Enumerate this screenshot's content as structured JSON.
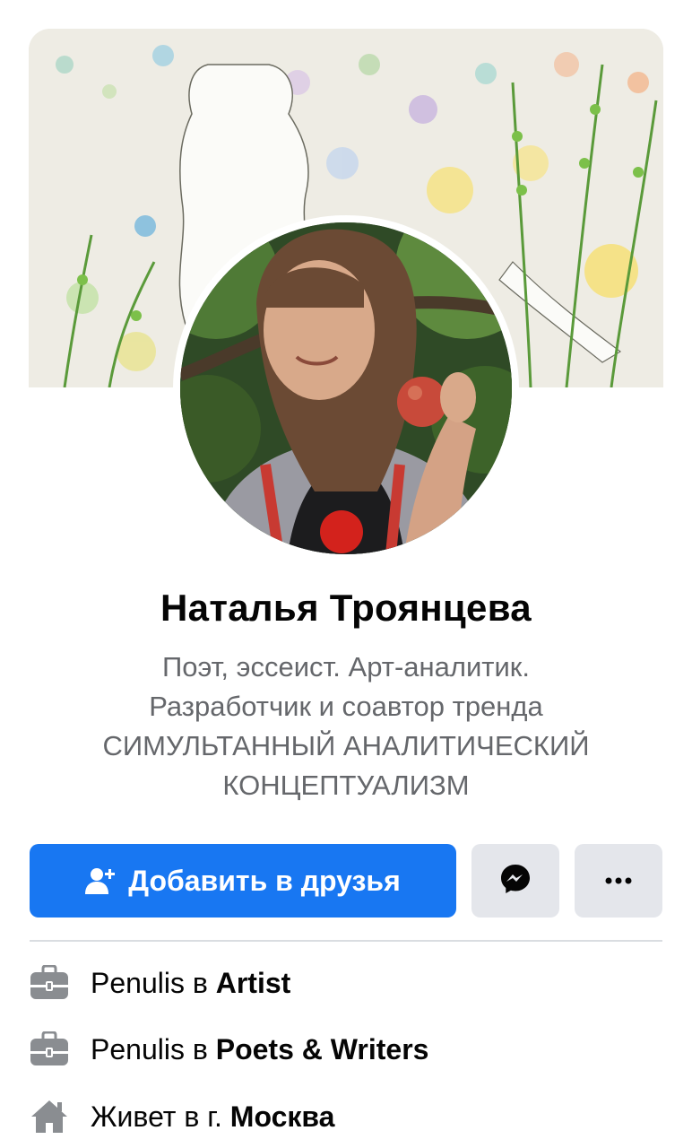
{
  "profile": {
    "name": "Наталья Троянцева",
    "bio_lines": [
      "Поэт, эссеист. Арт-аналитик.",
      "Разработчик и соавтор тренда",
      "СИМУЛЬТАННЫЙ АНАЛИТИЧЕСКИЙ",
      "КОНЦЕПТУАЛИЗМ"
    ]
  },
  "actions": {
    "add_friend_label": "Добавить в друзья",
    "add_friend_icon": "add-user-icon",
    "messenger_icon": "messenger-icon",
    "more_label": "···"
  },
  "info": [
    {
      "icon": "briefcase-icon",
      "prefix": "Penulis в ",
      "value": "Artist"
    },
    {
      "icon": "briefcase-icon",
      "prefix": "Penulis в ",
      "value": "Poets & Writers"
    },
    {
      "icon": "home-icon",
      "prefix": "Живет в г. ",
      "value": "Москва"
    }
  ],
  "colors": {
    "primary": "#1877f2",
    "secondary_button": "#e4e6eb",
    "secondary_text": "#65676b",
    "icon_gray": "#8a8d91"
  }
}
